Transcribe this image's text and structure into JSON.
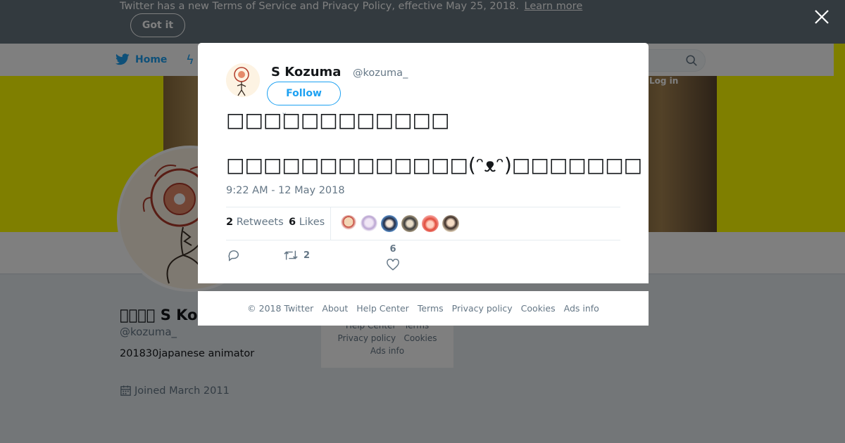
{
  "terms_bar": {
    "text": "Twitter has a new Terms of Service and Privacy Policy, effective May 25, 2018.",
    "link": "Learn more",
    "button": "Got it"
  },
  "nav": {
    "home_label": "Home",
    "login_label": "Log in"
  },
  "profile": {
    "name": "\u0000\u0000\u0000\u0000 S Ko",
    "handle": "@kozuma_",
    "bio": "201830japanese animator",
    "joined": "Joined March 2011"
  },
  "side_footer": {
    "line1_a": "Help Center",
    "line1_b": "Terms",
    "line2_a": "Privacy policy",
    "line2_b": "Cookies",
    "line3": "Ads info"
  },
  "tweet": {
    "author_name": "S Kozuma",
    "author_handle": "@kozuma_",
    "follow_label": "Follow",
    "text_line1": "□□□□□□□□□□□□",
    "text_line2": "□□□□□□□□□□□□□(ᵔᴥᵔ)□□□□□□□",
    "time": "9:22 AM - 12 May 2018",
    "retweets_count": "2",
    "retweets_label": "Retweets",
    "likes_count": "6",
    "likes_label": "Likes",
    "reply_count": "",
    "action_retweet_count": "2",
    "action_like_count": "6"
  },
  "footer": {
    "copyright": "© 2018 Twitter",
    "about": "About",
    "help": "Help Center",
    "terms": "Terms",
    "privacy": "Privacy policy",
    "cookies": "Cookies",
    "ads": "Ads info"
  },
  "colors": {
    "accent": "#1da1f2",
    "banner": "#ffff00",
    "overlay": "rgba(0,0,0,0.5)"
  },
  "icons": {
    "close": "close-icon",
    "bird": "twitter-bird-icon",
    "search": "search-icon",
    "reply": "reply-icon",
    "retweet": "retweet-icon",
    "like": "heart-icon",
    "calendar": "calendar-icon"
  }
}
